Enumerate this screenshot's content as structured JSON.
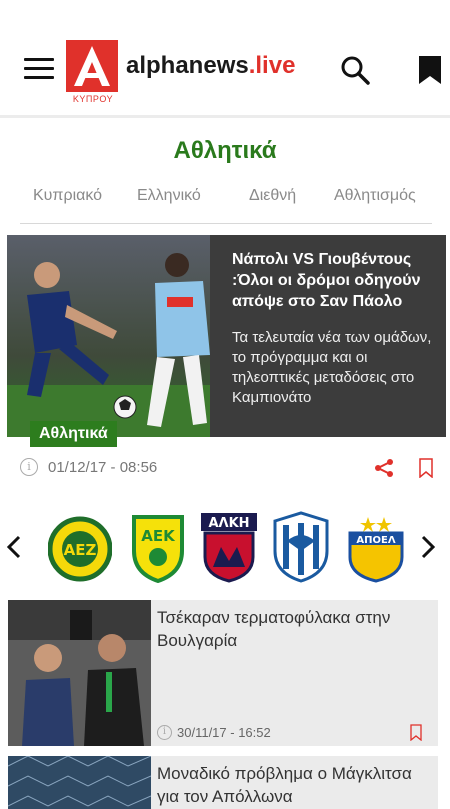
{
  "header": {
    "logo_text_main": "alphanews",
    "logo_text_accent": ".live",
    "logo_subtitle": "ΚΥΠΡΟΥ",
    "icons": [
      "menu-icon",
      "alpha-logo",
      "search-icon",
      "bookmark-icon"
    ]
  },
  "section": {
    "title": "Αθλητικά"
  },
  "tabs": [
    "Κυπριακό",
    "Ελληνικό",
    "Διεθνή",
    "Αθλητισμός"
  ],
  "hero": {
    "title": "Νάπολι VS Γιουβέντους :Όλοι οι δρόμοι οδηγούν απόψε στο Σαν Πάολο",
    "description": "Τα τελευταία νέα των ομάδων, το πρόγραμμα και οι τηλεοπτικές μεταδόσεις στο Καμπιονάτο",
    "badge": "Αθλητικά",
    "date": "01/12/17 - 08:56"
  },
  "carousel": {
    "teams": [
      "aez-crest",
      "aek-larnaca-crest",
      "alki-crest",
      "anorthosis-crest",
      "apoel-crest"
    ]
  },
  "articles": [
    {
      "title": "Τσέκαραν τερματοφύλακα στην Βουλγαρία",
      "date": "30/11/17 - 16:52"
    },
    {
      "title": "Μοναδικό πρόβλημα ο Μάγκλιτσα για τον Απόλλωνα",
      "date": ""
    }
  ],
  "colors": {
    "accent_red": "#e0312b",
    "section_green": "#2a7a1c",
    "badge_green": "#2d7d1e",
    "hero_bg": "#3c3c3c",
    "card_bg": "#ebebeb"
  }
}
